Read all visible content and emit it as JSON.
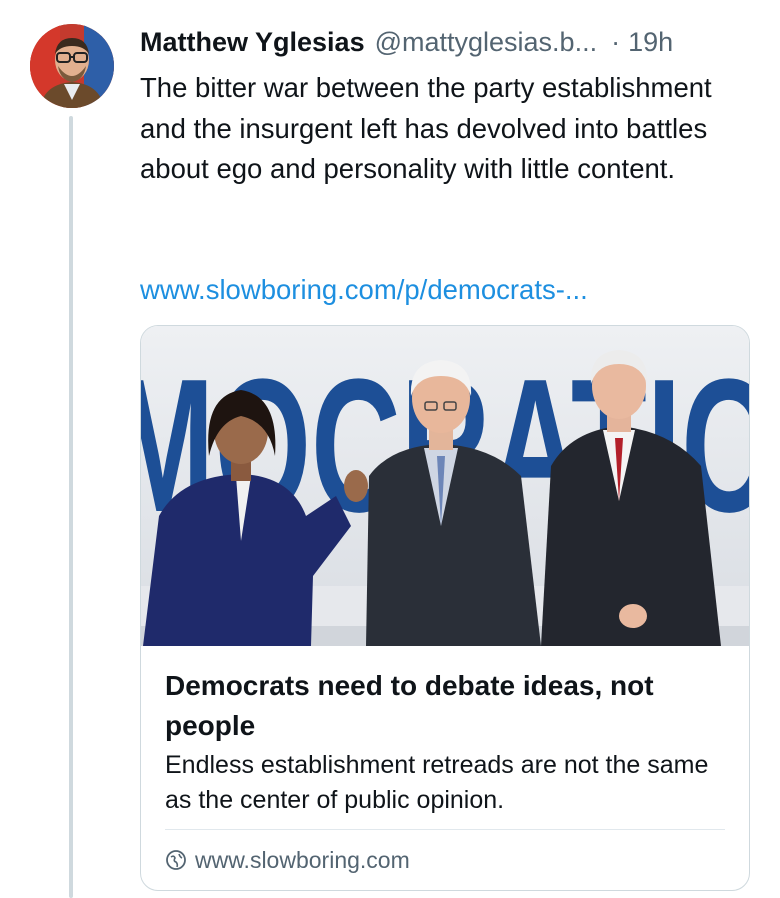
{
  "post": {
    "author_name": "Matthew Yglesias",
    "author_handle": "@mattyglesias.b...",
    "separator": "·",
    "time": "19h",
    "text": "The bitter war between the party establishment and the insurgent left has devolved into battles about ego and personality with little content.",
    "link_text": "www.slowboring.com/p/democrats-..."
  },
  "card": {
    "banner_text": "MOCRATIC",
    "title": "Democrats need to debate ideas, not people",
    "description": "Endless establishment retreads are not the same as the center of public opinion.",
    "domain": "www.slowboring.com",
    "domain_icon": "globe-icon"
  },
  "colors": {
    "link": "#1d8fe0",
    "secondary_text": "#536471",
    "thread_line": "#cfd9de",
    "banner_blue": "#1d4f96"
  }
}
